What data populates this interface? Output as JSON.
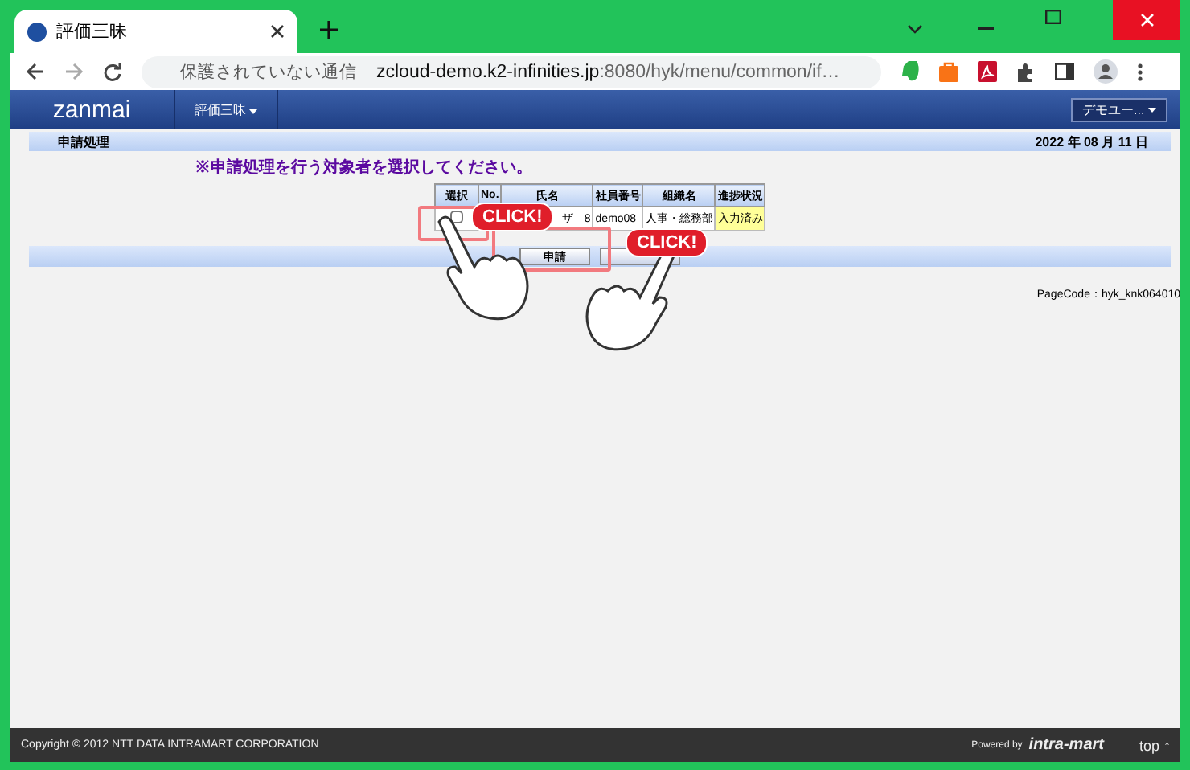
{
  "browser": {
    "tab_title": "評価三昧",
    "address_warning": "保護されていない通信",
    "url_host": "zcloud-demo.k2-infinities.jp",
    "url_path": ":8080/hyk/menu/common/if…"
  },
  "app": {
    "logo": "zanmai",
    "menu": "評価三昧",
    "user_menu": "デモユー..."
  },
  "page": {
    "title": "申請処理",
    "date": "2022 年 08 月 11 日",
    "instruction": "※申請処理を行う対象者を選択してください。"
  },
  "table": {
    "columns": [
      "選択",
      "No.",
      "氏名",
      "社員番号",
      "組織名",
      "進捗状況"
    ],
    "rows": [
      {
        "checked": false,
        "name": "ザ　8",
        "employee_no": "demo08",
        "org": "人事・総務部",
        "status": "入力済み"
      }
    ]
  },
  "buttons": [
    {
      "label": "申請"
    }
  ],
  "callouts": [
    "CLICK!",
    "CLICK!"
  ],
  "page_code": "PageCode：hyk_knk064010",
  "footer": {
    "copyright": "Copyright © 2012 NTT DATA INTRAMART CORPORATION",
    "powered": "Powered by",
    "brand": "intra-mart",
    "top": "top ↑"
  }
}
